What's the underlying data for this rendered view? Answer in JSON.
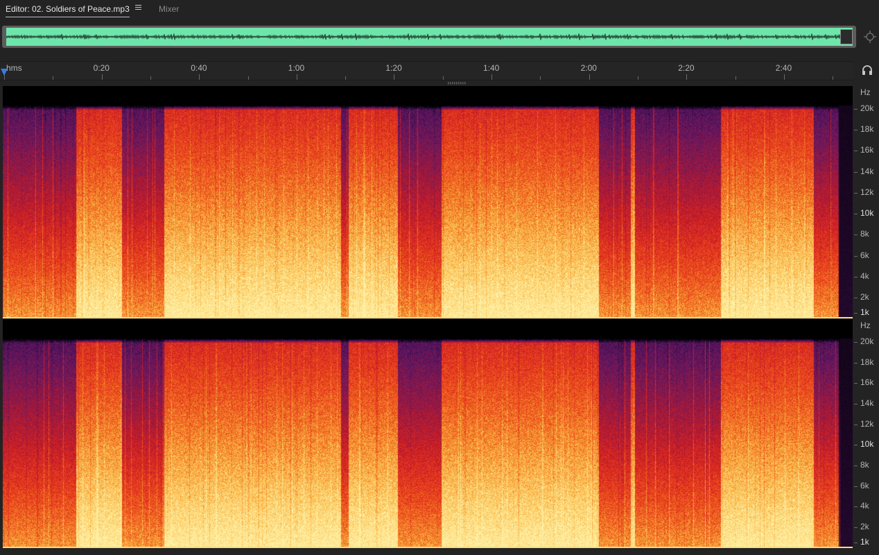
{
  "tabs": {
    "editor_label": "Editor: 02. Soldiers of Peace.mp3",
    "mixer_label": "Mixer"
  },
  "ruler": {
    "format_label": "hms",
    "labels": [
      "0:20",
      "0:40",
      "1:00",
      "1:20",
      "1:40",
      "2:00",
      "2:20",
      "2:40"
    ]
  },
  "frequency_axis": {
    "unit": "Hz",
    "labels": [
      "20k",
      "18k",
      "16k",
      "14k",
      "12k",
      "10k",
      "8k",
      "6k",
      "4k",
      "2k",
      "1k"
    ]
  },
  "colors": {
    "overview_waveform": "#6ee6ab",
    "playhead": "#3b7be0",
    "spectrogram_palette": [
      "#000000",
      "#2a0c3a",
      "#5a1a6e",
      "#8e1f4a",
      "#c21e2a",
      "#e64a1c",
      "#f5921e",
      "#fbd35a",
      "#fff2a8"
    ]
  },
  "icons": {
    "tab_menu": "hamburger-menu-icon",
    "zoom": "zoom-navigator-icon",
    "monitor": "headphones-icon"
  }
}
